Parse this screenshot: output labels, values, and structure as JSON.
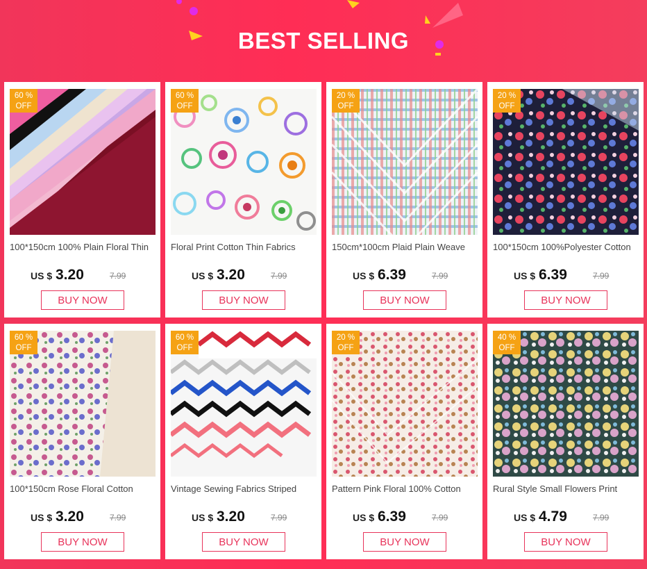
{
  "header": {
    "title": "BEST SELLING"
  },
  "currency_label": "US $",
  "buy_label": "BUY NOW",
  "products": [
    {
      "name": "100*150cm 100% Plain Floral Thin",
      "price": "3.20",
      "old_price": "7.99",
      "badge_percent": "60 %",
      "badge_off": "OFF",
      "image": "plain-solid-fabrics"
    },
    {
      "name": "Floral Print Cotton Thin Fabrics",
      "price": "3.20",
      "old_price": "7.99",
      "badge_percent": "60 %",
      "badge_off": "OFF",
      "image": "circle-print-fabrics"
    },
    {
      "name": "150cm*100cm Plaid Plain Weave",
      "price": "6.39",
      "old_price": "7.99",
      "badge_percent": "20 %",
      "badge_off": "OFF",
      "image": "plaid-fabrics"
    },
    {
      "name": "100*150cm 100%Polyester Cotton",
      "price": "6.39",
      "old_price": "7.99",
      "badge_percent": "20 %",
      "badge_off": "OFF",
      "image": "dark-floral-fabrics"
    },
    {
      "name": "100*150cm Rose Floral Cotton",
      "price": "3.20",
      "old_price": "7.99",
      "badge_percent": "60 %",
      "badge_off": "OFF",
      "image": "rose-floral-fabrics"
    },
    {
      "name": "Vintage Sewing Fabrics Striped",
      "price": "3.20",
      "old_price": "7.99",
      "badge_percent": "60 %",
      "badge_off": "OFF",
      "image": "chevron-fabrics"
    },
    {
      "name": "Pattern Pink Floral 100% Cotton",
      "price": "6.39",
      "old_price": "7.99",
      "badge_percent": "20 %",
      "badge_off": "OFF",
      "image": "pink-floral-fabrics"
    },
    {
      "name": "Rural Style Small Flowers Print",
      "price": "4.79",
      "old_price": "7.99",
      "badge_percent": "40 %",
      "badge_off": "OFF",
      "image": "rural-flower-fabrics"
    }
  ],
  "colors": {
    "accent": "#e8335a",
    "badge": "#f5a214",
    "background": "#f1355a"
  }
}
